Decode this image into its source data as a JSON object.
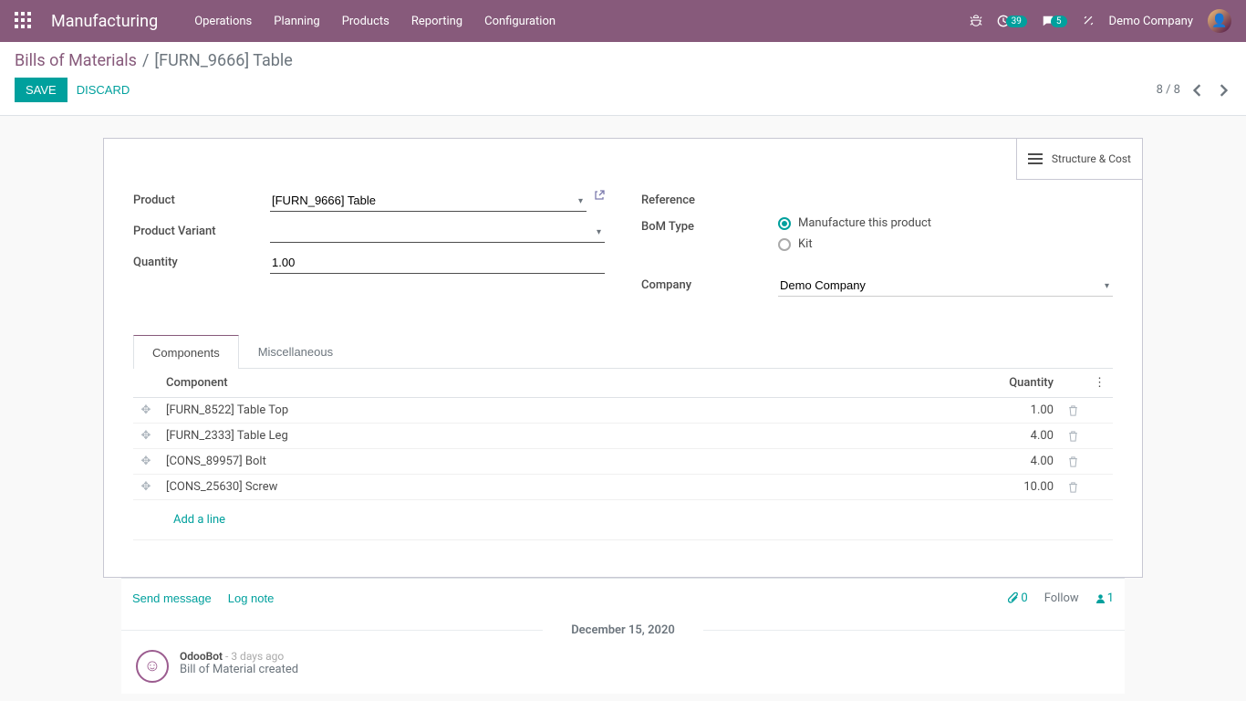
{
  "navbar": {
    "brand": "Manufacturing",
    "menu": [
      "Operations",
      "Planning",
      "Products",
      "Reporting",
      "Configuration"
    ],
    "badges": {
      "clock": "39",
      "chat": "5"
    },
    "company": "Demo Company"
  },
  "breadcrumb": {
    "root": "Bills of Materials",
    "current": "[FURN_9666] Table"
  },
  "buttons": {
    "save": "Save",
    "discard": "Discard"
  },
  "pager": {
    "text": "8 / 8"
  },
  "stat_button": {
    "label": "Structure & Cost"
  },
  "form": {
    "labels": {
      "product": "Product",
      "variant": "Product Variant",
      "quantity": "Quantity",
      "reference": "Reference",
      "bom_type": "BoM Type",
      "company": "Company"
    },
    "values": {
      "product": "[FURN_9666] Table",
      "variant": "",
      "quantity": "1.00",
      "reference": "",
      "company": "Demo Company"
    },
    "bom_type_options": {
      "manufacture": "Manufacture this product",
      "kit": "Kit"
    }
  },
  "tabs": {
    "components": "Components",
    "misc": "Miscellaneous"
  },
  "table": {
    "headers": {
      "component": "Component",
      "quantity": "Quantity"
    },
    "rows": [
      {
        "component": "[FURN_8522] Table Top",
        "qty": "1.00"
      },
      {
        "component": "[FURN_2333] Table Leg",
        "qty": "4.00"
      },
      {
        "component": "[CONS_89957] Bolt",
        "qty": "4.00"
      },
      {
        "component": "[CONS_25630] Screw",
        "qty": "10.00"
      }
    ],
    "add_line": "Add a line"
  },
  "chatter": {
    "send": "Send message",
    "log": "Log note",
    "attach_count": "0",
    "follow": "Follow",
    "follower_count": "1",
    "date": "December 15, 2020",
    "msg": {
      "author": "OdooBot",
      "ago": "- 3 days ago",
      "body": "Bill of Material created"
    }
  }
}
